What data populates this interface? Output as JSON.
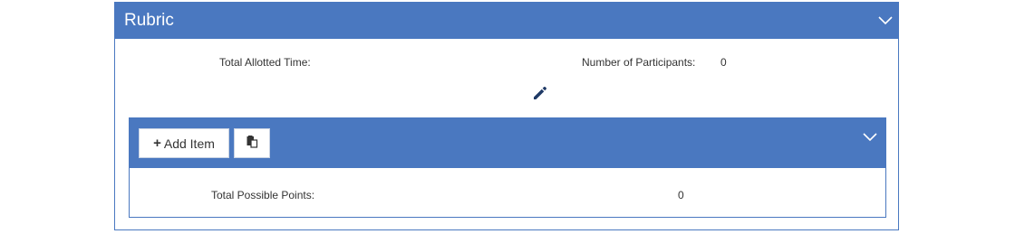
{
  "rubric": {
    "title": "Rubric",
    "total_allotted_time_label": "Total Allotted Time:",
    "total_allotted_time_value": "",
    "participants_label": "Number of Participants:",
    "participants_value": "0"
  },
  "items_section": {
    "add_item_label": "Add Item",
    "total_points_label": "Total Possible Points:",
    "total_points_value": "0"
  },
  "colors": {
    "header_blue": "#4a78c0",
    "edit_icon": "#1f3a66"
  },
  "icons": {
    "collapse": "chevron-down-icon",
    "edit": "pencil-icon",
    "add": "plus-icon",
    "paste": "paste-icon"
  }
}
